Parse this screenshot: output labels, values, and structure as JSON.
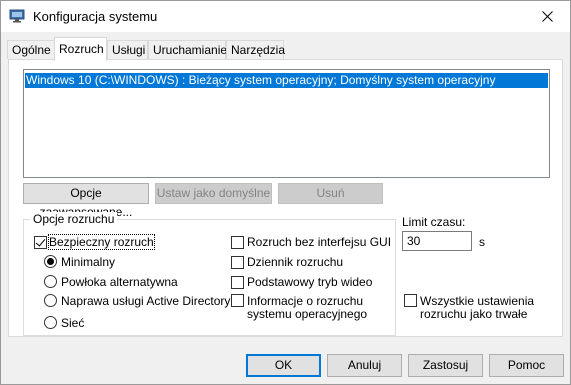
{
  "window": {
    "title": "Konfiguracja systemu",
    "icon": "system-config-icon",
    "close_icon": "close-icon"
  },
  "tabs": [
    {
      "label": "Ogólne",
      "active": false
    },
    {
      "label": "Rozruch",
      "active": true
    },
    {
      "label": "Usługi",
      "active": false
    },
    {
      "label": "Uruchamianie",
      "active": false
    },
    {
      "label": "Narzędzia",
      "active": false
    }
  ],
  "boot_list": {
    "items": [
      "Windows 10 (C:\\WINDOWS) : Bieżący system operacyjny; Domyślny system operacyjny"
    ],
    "selected_index": 0
  },
  "list_buttons": {
    "advanced": "Opcje zaawansowane...",
    "set_default": "Ustaw jako domyślne",
    "delete": "Usuń"
  },
  "boot_options": {
    "group_label": "Opcje rozruchu",
    "safe_boot": {
      "label": "Bezpieczny rozruch",
      "checked": true
    },
    "modes": [
      {
        "label": "Minimalny",
        "checked": true
      },
      {
        "label": "Powłoka alternatywna",
        "checked": false
      },
      {
        "label": "Naprawa usługi Active Directory",
        "checked": false
      },
      {
        "label": "Sieć",
        "checked": false
      }
    ],
    "no_gui": {
      "label": "Rozruch bez interfejsu GUI",
      "checked": false
    },
    "boot_log": {
      "label": "Dziennik rozruchu",
      "checked": false
    },
    "base_video": {
      "label": "Podstawowy tryb wideo",
      "checked": false
    },
    "os_boot_info": {
      "label_line1": "Informacje o rozruchu",
      "label_line2": "systemu operacyjnego",
      "checked": false
    }
  },
  "timeout": {
    "label": "Limit czasu:",
    "value": "30",
    "unit": "s"
  },
  "permanent": {
    "label_line1": "Wszystkie ustawienia",
    "label_line2": "rozruchu jako trwałe",
    "checked": false
  },
  "dialog_buttons": {
    "ok": "OK",
    "cancel": "Anuluj",
    "apply": "Zastosuj",
    "help": "Pomoc"
  },
  "colors": {
    "selection": "#0078d7",
    "accent": "#0078d7"
  }
}
